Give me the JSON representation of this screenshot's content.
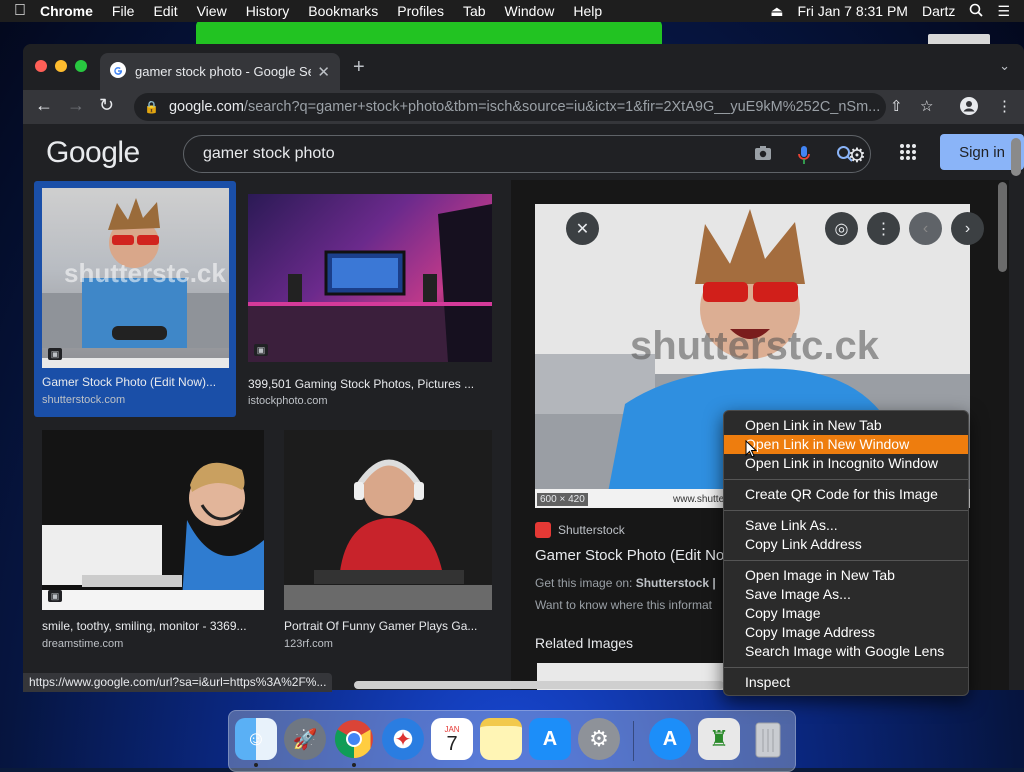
{
  "menubar": {
    "app": "Chrome",
    "items": [
      "File",
      "Edit",
      "View",
      "History",
      "Bookmarks",
      "Profiles",
      "Tab",
      "Window",
      "Help"
    ],
    "clock": "Fri Jan 7  8:31 PM",
    "user": "Dartz"
  },
  "browser": {
    "tab_title": "gamer stock photo - Google Se",
    "url_host": "google.com",
    "url_path": "/search?q=gamer+stock+photo&tbm=isch&source=iu&ictx=1&fir=2XtA9G__yuE9kM%252C_nSm..."
  },
  "google": {
    "logo": "Google",
    "query": "gamer stock photo",
    "signin_label": "Sign in"
  },
  "results": [
    {
      "caption": "Gamer Stock Photo (Edit Now)...",
      "site": "shutterstock.com"
    },
    {
      "caption": "399,501 Gaming Stock Photos, Pictures ...",
      "site": "istockphoto.com"
    },
    {
      "caption": "smile, toothy, smiling, monitor - 3369...",
      "site": "dreamstime.com"
    },
    {
      "caption": "Portrait Of Funny Gamer Plays Ga...",
      "site": "123rf.com"
    }
  ],
  "watermark": "shutterstc.ck",
  "panel": {
    "dimensions": "600 × 420",
    "site_label": "www.shutte",
    "source": "Shutterstock",
    "title": "Gamer Stock Photo (Edit No",
    "get_image_prefix": "Get this image on: ",
    "get_image_source": "Shutterstock |",
    "want_to_know": "Want to know where this informat",
    "related": "Related Images"
  },
  "status_url": "https://www.google.com/url?sa=i&url=https%3A%2F%...",
  "context_menu": {
    "group1": [
      "Open Link in New Tab",
      "Open Link in New Window",
      "Open Link in Incognito Window"
    ],
    "group2": [
      "Create QR Code for this Image"
    ],
    "group3": [
      "Save Link As...",
      "Copy Link Address"
    ],
    "group4": [
      "Open Image in New Tab",
      "Save Image As...",
      "Copy Image",
      "Copy Image Address",
      "Search Image with Google Lens"
    ],
    "group5": [
      "Inspect"
    ],
    "highlighted": "Open Link in New Window"
  },
  "dock": {
    "calendar_month": "JAN",
    "calendar_day": "7",
    "apps": [
      "finder-icon",
      "launchpad-icon",
      "chrome-icon",
      "safari-icon",
      "calendar-icon",
      "notes-icon",
      "app-store-icon",
      "system-preferences-icon",
      "app-store-download-icon",
      "game-app-icon",
      "trash-icon"
    ]
  },
  "colors": {
    "accent_blue": "#8ab4f8",
    "selection_blue": "#1a4fa8",
    "menu_highlight": "#ee7d0e"
  }
}
